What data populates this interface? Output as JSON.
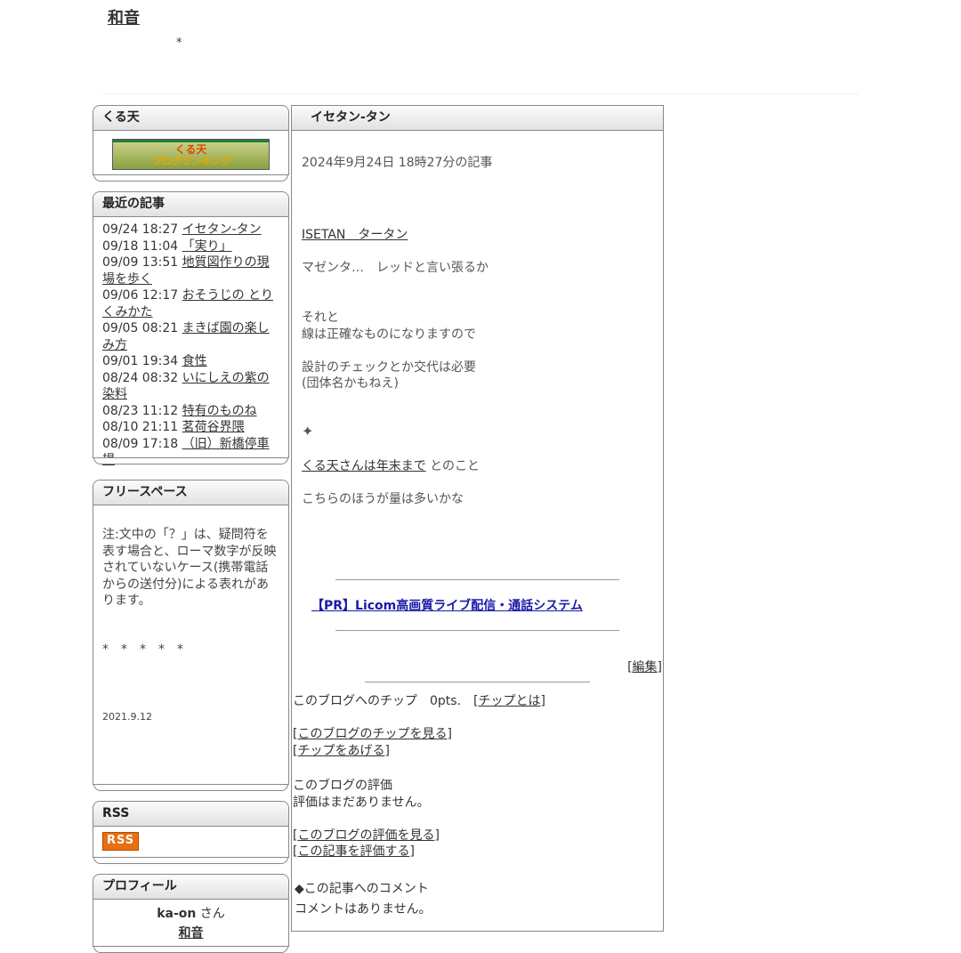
{
  "blog": {
    "title": "和音",
    "subtitle": "*"
  },
  "sidebar": {
    "kuruten": {
      "title": "くる天",
      "banner_text_top": "くる天",
      "banner_text_bottom": "ブログランキング"
    },
    "recent": {
      "title": "最近の記事",
      "items": [
        {
          "date": "09/24 18:27",
          "title": "イセタン-タン"
        },
        {
          "date": "09/18 11:04",
          "title": "「実り」"
        },
        {
          "date": "09/09 13:51",
          "title": "地質図作りの現場を歩く"
        },
        {
          "date": "09/06 12:17",
          "title": "おそうじの とりくみかた"
        },
        {
          "date": "09/05 08:21",
          "title": "まきば園の楽しみ方"
        },
        {
          "date": "09/01 19:34",
          "title": "食性"
        },
        {
          "date": "08/24 08:32",
          "title": "いにしえの紫の染料"
        },
        {
          "date": "08/23 11:12",
          "title": "特有のものね"
        },
        {
          "date": "08/10 21:11",
          "title": "茗荷谷界隈"
        },
        {
          "date": "08/09 17:18",
          "title": "（旧）新橋停車場"
        }
      ]
    },
    "free": {
      "title": "フリースペース",
      "note": "注:文中の「？」は、疑問符を表す場合と、ローマ数字が反映されていないケース(携帯電話からの送付分)による表れがあります。",
      "stars": "*　*　*　*　*",
      "date": "2021.9.12"
    },
    "rss": {
      "title": "RSS",
      "badge": "RSS"
    },
    "profile": {
      "title": "プロフィール",
      "name": "ka-on",
      "honorific": "さん",
      "blog_link": "和音"
    }
  },
  "article": {
    "title": "イセタン-タン",
    "posted": "2024年9月24日 18時27分の記事",
    "link1": "ISETAN　タータン",
    "line1": "マゼンタ…　レッドと言い張るか",
    "line2": "それと",
    "line3": "線は正確なものになりますので",
    "line4": "設計のチェックとか交代は必要",
    "line5": "(団体名かもねえ)",
    "sparkle": "✦",
    "link2": "くる天さんは年末まで",
    "line6": " とのこと",
    "line7": "こちらのほうが量は多いかな",
    "pr": "【PR】Licom高画質ライブ配信・通話システム",
    "edit": "編集",
    "tip_text": "このブログへのチップ　0pts.",
    "tip_about": "チップとは",
    "tip_view": "このブログのチップを見る",
    "tip_give": "チップをあげる",
    "rating_title": "このブログの評価",
    "rating_none": "評価はまだありません。",
    "rating_view": "このブログの評価を見る",
    "rating_give": "この記事を評価する",
    "comment_title": "◆この記事へのコメント",
    "comment_none": "コメントはありません。"
  }
}
